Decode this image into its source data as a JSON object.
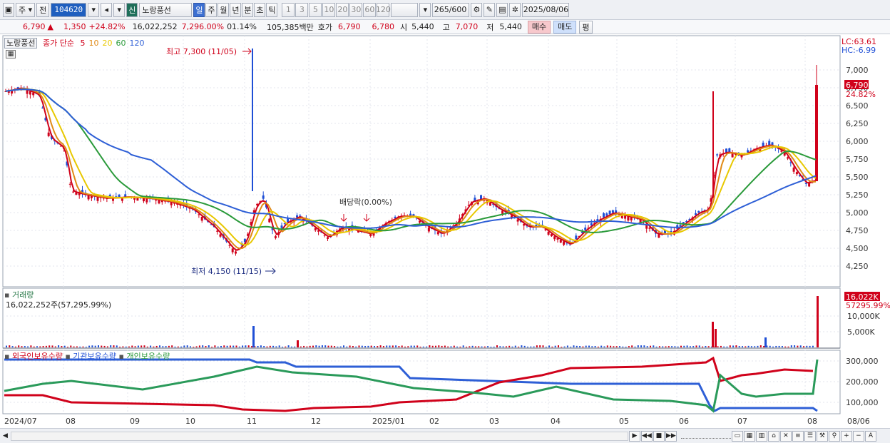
{
  "toolbar": {
    "period_type": "주",
    "prev_label": "전",
    "code": "104620",
    "market_badge": "신",
    "stock_name": "노랑풍선",
    "period_tabs": [
      "일",
      "주",
      "월",
      "년",
      "분",
      "초",
      "틱"
    ],
    "active_period": "일",
    "intervals": [
      "1",
      "3",
      "5",
      "10",
      "20",
      "30",
      "60",
      "120"
    ],
    "count": "265",
    "count_max": "/600",
    "date": "2025/08/06"
  },
  "quote": {
    "price": "6,790",
    "arrow": "▲",
    "change": "1,350",
    "change_pct": "+24.82%",
    "volume": "16,022,252",
    "volume_pct": "7,296.00%",
    "turnover": "01.14%",
    "amount": "105,385백만",
    "bid_label": "호가",
    "ask": "6,790",
    "bid": "6,780",
    "open_label": "시",
    "open": "5,440",
    "high_label": "고",
    "high": "7,070",
    "low_label": "저",
    "low": "5,440",
    "buy_label": "매수",
    "sell_label": "매도",
    "eval_label": "평"
  },
  "price_panel": {
    "legend_name": "노랑풍선",
    "legend_ma": "종가 단순",
    "ma_periods": [
      "5",
      "10",
      "20",
      "60",
      "120"
    ],
    "ma_colors": [
      "#d0021b",
      "#e08a16",
      "#e8c800",
      "#2a9a3a",
      "#2e5fd6"
    ],
    "lc_label": "LC:63.61",
    "hc_label": "HC:-6.99",
    "high_annotation": "최고 7,300 (11/05)",
    "low_annotation": "최저 4,150 (11/15)",
    "dividend_annotation": "배당락(0.00%)",
    "last_price_tag": "6,790",
    "last_change_tag": "24.82%",
    "y_ticks": [
      "7,000",
      "6,750",
      "6,500",
      "6,250",
      "6,000",
      "5,750",
      "5,500",
      "5,250",
      "5,000",
      "4,750",
      "4,500",
      "4,250"
    ]
  },
  "volume_panel": {
    "title": "거래량",
    "value": "16,022,252주(57,295.99%)",
    "tag_value": "16,022K",
    "tag_pct": "57295.99%",
    "y_ticks": [
      "10,000K",
      "5,000K"
    ]
  },
  "holding_panel": {
    "title_foreign": "외국인보유수량",
    "title_inst": "기관보유수량",
    "title_indiv": "개인보유수량",
    "y_ticks": [
      "300,000",
      "200,000",
      "100,000"
    ]
  },
  "x_axis": [
    "2024/07",
    "08",
    "09",
    "10",
    "11",
    "12",
    "2025/01",
    "02",
    "03",
    "04",
    "05",
    "06",
    "07",
    "08",
    "08/06"
  ],
  "colors": {
    "up": "#d0021b",
    "down": "#1f4fd6",
    "buy_bg": "#f7c8cc",
    "sell_bg": "#cfe0fb"
  }
}
